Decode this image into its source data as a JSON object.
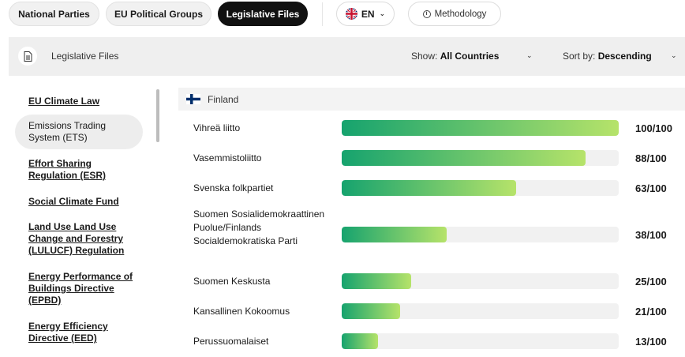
{
  "nav": {
    "tabs": [
      {
        "label": "National Parties",
        "active": false
      },
      {
        "label": "EU Political Groups",
        "active": false
      },
      {
        "label": "Legislative Files",
        "active": true
      }
    ],
    "language": {
      "label": "EN",
      "flag": "uk-flag-icon"
    },
    "methodology_label": "Methodology"
  },
  "toolbar": {
    "title": "Legislative Files",
    "show_prefix": "Show:",
    "show_value": "All Countries",
    "sort_prefix": "Sort by:",
    "sort_value": "Descending"
  },
  "sidebar": {
    "items": [
      {
        "label": "EU Climate Law",
        "selected": false
      },
      {
        "label": "Emissions Trading System (ETS)",
        "selected": true
      },
      {
        "label": "Effort Sharing Regulation (ESR)",
        "selected": false
      },
      {
        "label": "Social Climate Fund",
        "selected": false
      },
      {
        "label": "Land Use Land Use Change and Forestry (LULUCF) Regulation",
        "selected": false
      },
      {
        "label": "Energy Performance of Buildings Directive (EPBD)",
        "selected": false
      },
      {
        "label": "Energy Efficiency Directive (EED)",
        "selected": false
      }
    ]
  },
  "country": {
    "name": "Finland",
    "flag": "finland-flag-icon"
  },
  "parties": [
    {
      "name": "Vihreä liitto",
      "score": 100,
      "score_label": "100/100"
    },
    {
      "name": "Vasemmistoliitto",
      "score": 88,
      "score_label": "88/100"
    },
    {
      "name": "Svenska folkpartiet",
      "score": 63,
      "score_label": "63/100"
    },
    {
      "name": "Suomen Sosialidemokraattinen Puolue/Finlands Socialdemokratiska Parti",
      "score": 38,
      "score_label": "38/100"
    },
    {
      "name": "Suomen Keskusta",
      "score": 25,
      "score_label": "25/100"
    },
    {
      "name": "Kansallinen Kokoomus",
      "score": 21,
      "score_label": "21/100"
    },
    {
      "name": "Perussuomalaiset",
      "score": 13,
      "score_label": "13/100"
    }
  ],
  "colors": {
    "bar_start": "#16a36e",
    "bar_end": "#b6e36a",
    "active_tab": "#111111"
  }
}
